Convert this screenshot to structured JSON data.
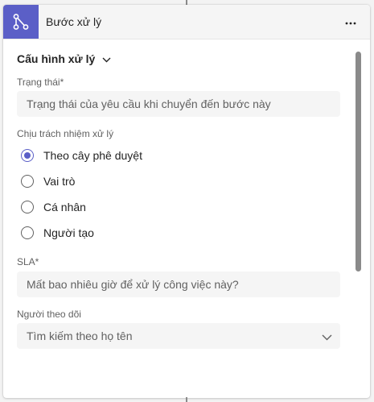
{
  "header": {
    "title": "Bước xử lý",
    "icon": "flow-branch-icon",
    "accent": "#5b5fc7"
  },
  "section": {
    "title": "Cấu hình xử lý"
  },
  "status_field": {
    "label": "Trạng thái*",
    "placeholder": "Trạng thái của yêu cầu khi chuyển đến bước này"
  },
  "responsibility": {
    "label": "Chịu trách nhiệm xử lý",
    "options": [
      {
        "label": "Theo cây phê duyệt",
        "selected": true
      },
      {
        "label": "Vai trò",
        "selected": false
      },
      {
        "label": "Cá nhân",
        "selected": false
      },
      {
        "label": "Người tạo",
        "selected": false
      }
    ]
  },
  "sla_field": {
    "label": "SLA*",
    "placeholder": "Mất bao nhiêu giờ để xử lý công việc này?"
  },
  "watchers_field": {
    "label": "Người theo dõi",
    "placeholder": "Tìm kiếm theo họ tên"
  }
}
